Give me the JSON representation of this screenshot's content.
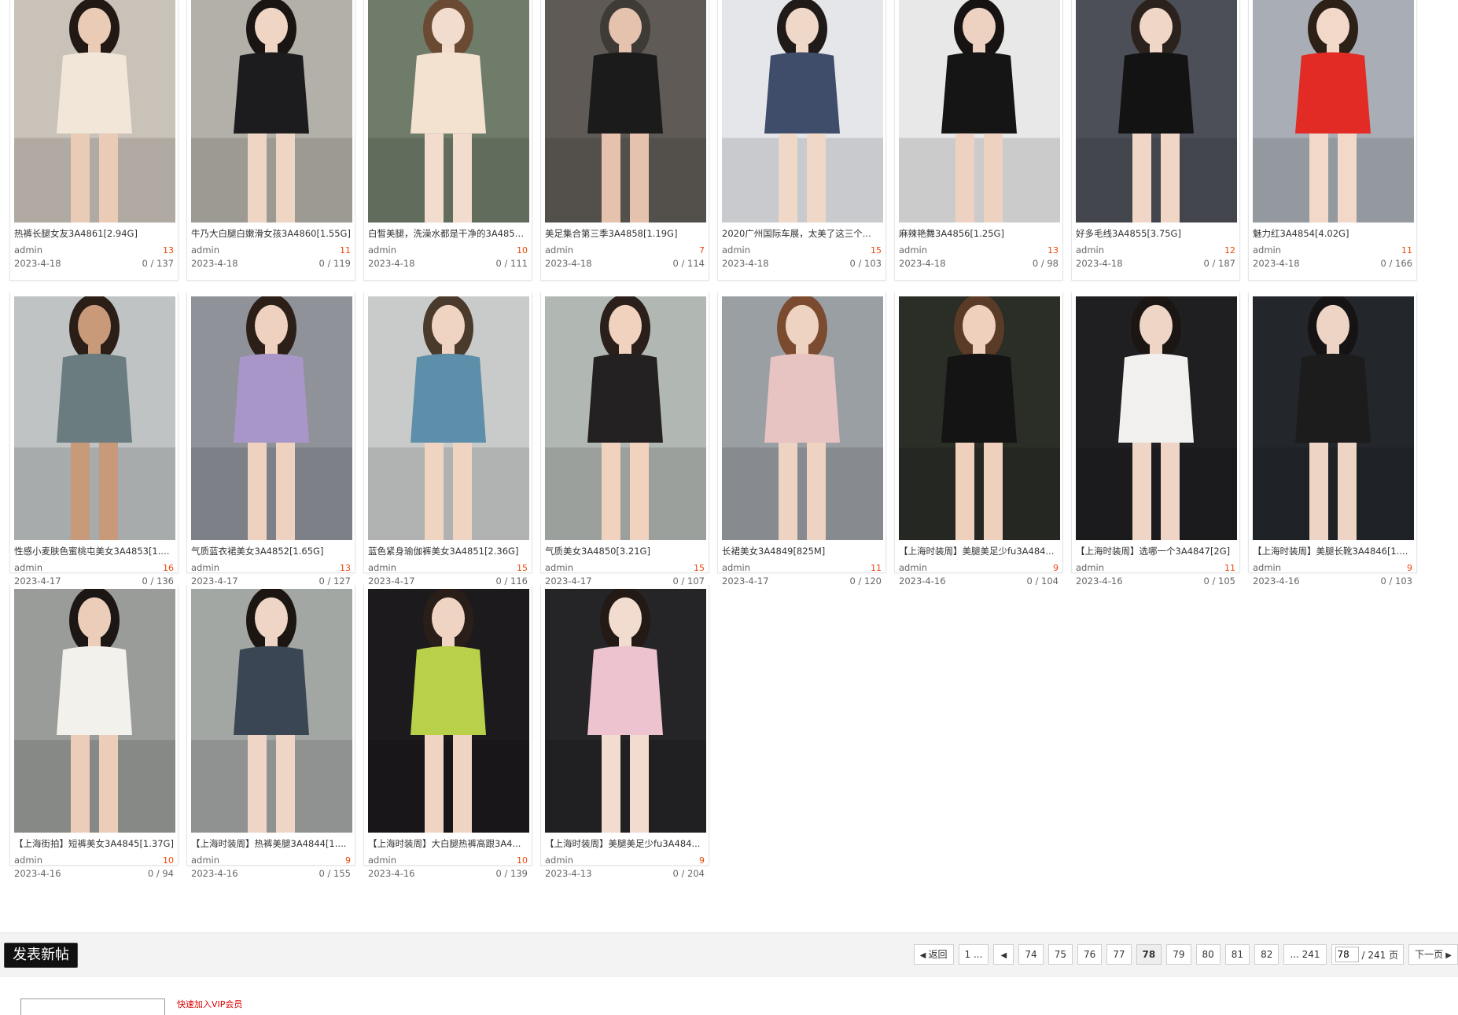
{
  "posts": [
    [
      {
        "title": "热裤长腿女友3A4861[2.94G]",
        "author": "admin",
        "date": "2023-4-18",
        "count": "13",
        "views": "0 / 137",
        "bg": "#c9c2b9",
        "skin": "#e9cbb6",
        "outfit": "#f1e6d8",
        "hair": "#221915"
      },
      {
        "title": "牛乃大白腿白嫩滑女孩3A4860[1.55G]",
        "author": "admin",
        "date": "2023-4-18",
        "count": "11",
        "views": "0 / 119",
        "bg": "#b3b0a9",
        "skin": "#efd6c4",
        "outfit": "#1c1c1e",
        "hair": "#1a1513"
      },
      {
        "title": "白皙美腿，洗澡水都是干净的3A4859...",
        "author": "admin",
        "date": "2023-4-18",
        "count": "10",
        "views": "0 / 111",
        "bg": "#6f7c6a",
        "skin": "#f1dccd",
        "outfit": "#f2e2cf",
        "hair": "#6b4a33"
      },
      {
        "title": "美足集合第三季3A4858[1.19G]",
        "author": "admin",
        "date": "2023-4-18",
        "count": "7",
        "views": "0 / 114",
        "bg": "#5f5a55",
        "skin": "#e5c2ad",
        "outfit": "#1b1b1b",
        "hair": "#3e3a36"
      },
      {
        "title": "2020广州国际车展，太美了这三个...",
        "author": "admin",
        "date": "2023-4-18",
        "count": "15",
        "views": "0 / 103",
        "bg": "#e4e6ea",
        "skin": "#efd8c8",
        "outfit": "#3f4d6a",
        "hair": "#201a18"
      },
      {
        "title": "麻辣艳舞3A4856[1.25G]",
        "author": "admin",
        "date": "2023-4-18",
        "count": "13",
        "views": "0 / 98",
        "bg": "#e8e8e8",
        "skin": "#edd2c1",
        "outfit": "#151515",
        "hair": "#161312"
      },
      {
        "title": "好多毛线3A4855[3.75G]",
        "author": "admin",
        "date": "2023-4-18",
        "count": "12",
        "views": "0 / 187",
        "bg": "#4d4f58",
        "skin": "#f0d6c6",
        "outfit": "#131313",
        "hair": "#2b221d"
      },
      {
        "title": "魅力红3A4854[4.02G]",
        "author": "admin",
        "date": "2023-4-18",
        "count": "11",
        "views": "0 / 166",
        "bg": "#a9aeb6",
        "skin": "#f2d8c9",
        "outfit": "#e22b24",
        "hair": "#2c2017"
      }
    ],
    [
      {
        "title": "性感小麦肤色蜜桃屯美女3A4853[1....",
        "author": "admin",
        "date": "2023-4-17",
        "count": "16",
        "views": "0 / 136",
        "bg": "#bfc3c4",
        "skin": "#c99a7a",
        "outfit": "#6a7c80",
        "hair": "#2a1e17"
      },
      {
        "title": "气质蓝衣裙美女3A4852[1.65G]",
        "author": "admin",
        "date": "2023-4-17",
        "count": "13",
        "views": "0 / 127",
        "bg": "#8f9299",
        "skin": "#efd1bf",
        "outfit": "#a996c9",
        "hair": "#2b1f18"
      },
      {
        "title": "蓝色紧身瑜伽裤美女3A4851[2.36G]",
        "author": "admin",
        "date": "2023-4-17",
        "count": "15",
        "views": "0 / 116",
        "bg": "#c8cbc9",
        "skin": "#efd4c2",
        "outfit": "#5d8eaa",
        "hair": "#4a3a2c"
      },
      {
        "title": "气质美女3A4850[3.21G]",
        "author": "admin",
        "date": "2023-4-17",
        "count": "15",
        "views": "0 / 107",
        "bg": "#b1b7b3",
        "skin": "#f0d2bf",
        "outfit": "#222020",
        "hair": "#2a1f1a"
      },
      {
        "title": "长裙美女3A4849[825M]",
        "author": "admin",
        "date": "2023-4-17",
        "count": "11",
        "views": "0 / 120",
        "bg": "#9a9fa3",
        "skin": "#efd3c2",
        "outfit": "#e7c3c2",
        "hair": "#7a4b2f"
      },
      {
        "title": "【上海时装周】美腿美足少fu3A484...",
        "author": "admin",
        "date": "2023-4-16",
        "count": "9",
        "views": "0 / 104",
        "bg": "#2b2d27",
        "skin": "#efd0bd",
        "outfit": "#141414",
        "hair": "#5a3b27"
      },
      {
        "title": "【上海时装周】选哪一个3A4847[2G]",
        "author": "admin",
        "date": "2023-4-16",
        "count": "11",
        "views": "0 / 105",
        "bg": "#1f1f22",
        "skin": "#efd5c6",
        "outfit": "#f1f0ee",
        "hair": "#1b1613"
      },
      {
        "title": "【上海时装周】美腿长靴3A4846[1....",
        "author": "admin",
        "date": "2023-4-16",
        "count": "9",
        "views": "0 / 103",
        "bg": "#23262b",
        "skin": "#eed4c5",
        "outfit": "#1c1c1c",
        "hair": "#161314"
      }
    ],
    [
      {
        "title": "【上海街拍】短裤美女3A4845[1.37G]",
        "author": "admin",
        "date": "2023-4-16",
        "count": "10",
        "views": "0 / 94",
        "bg": "#9a9c99",
        "skin": "#ebcdb9",
        "outfit": "#f3f1ec",
        "hair": "#1c1714"
      },
      {
        "title": "【上海时装周】热裤美腿3A4844[1....",
        "author": "admin",
        "date": "2023-4-16",
        "count": "9",
        "views": "0 / 155",
        "bg": "#a3a7a4",
        "skin": "#efd5c5",
        "outfit": "#3b4654",
        "hair": "#1c1613"
      },
      {
        "title": "【上海时装周】大白腿热裤高跟3A4...",
        "author": "admin",
        "date": "2023-4-16",
        "count": "10",
        "views": "0 / 139",
        "bg": "#1c1a1d",
        "skin": "#f0d4c3",
        "outfit": "#b8d04a",
        "hair": "#2a1e19"
      },
      {
        "title": "【上海时装周】美腿美足少fu3A484...",
        "author": "admin",
        "date": "2023-4-13",
        "count": "9",
        "views": "0 / 204",
        "bg": "#252427",
        "skin": "#f2dccf",
        "outfit": "#ecc3cf",
        "hair": "#231a16"
      }
    ]
  ],
  "bar": {
    "post_button": "发表新帖",
    "back": "返回",
    "first": "1 ...",
    "pages": [
      "74",
      "75",
      "76",
      "77",
      "78",
      "79",
      "80",
      "81",
      "82"
    ],
    "current": "78",
    "last": "... 241",
    "jump_value": "78",
    "total": "/ 241 页",
    "next": "下一页"
  },
  "footer": {
    "note": "快速加入VIP会员"
  }
}
